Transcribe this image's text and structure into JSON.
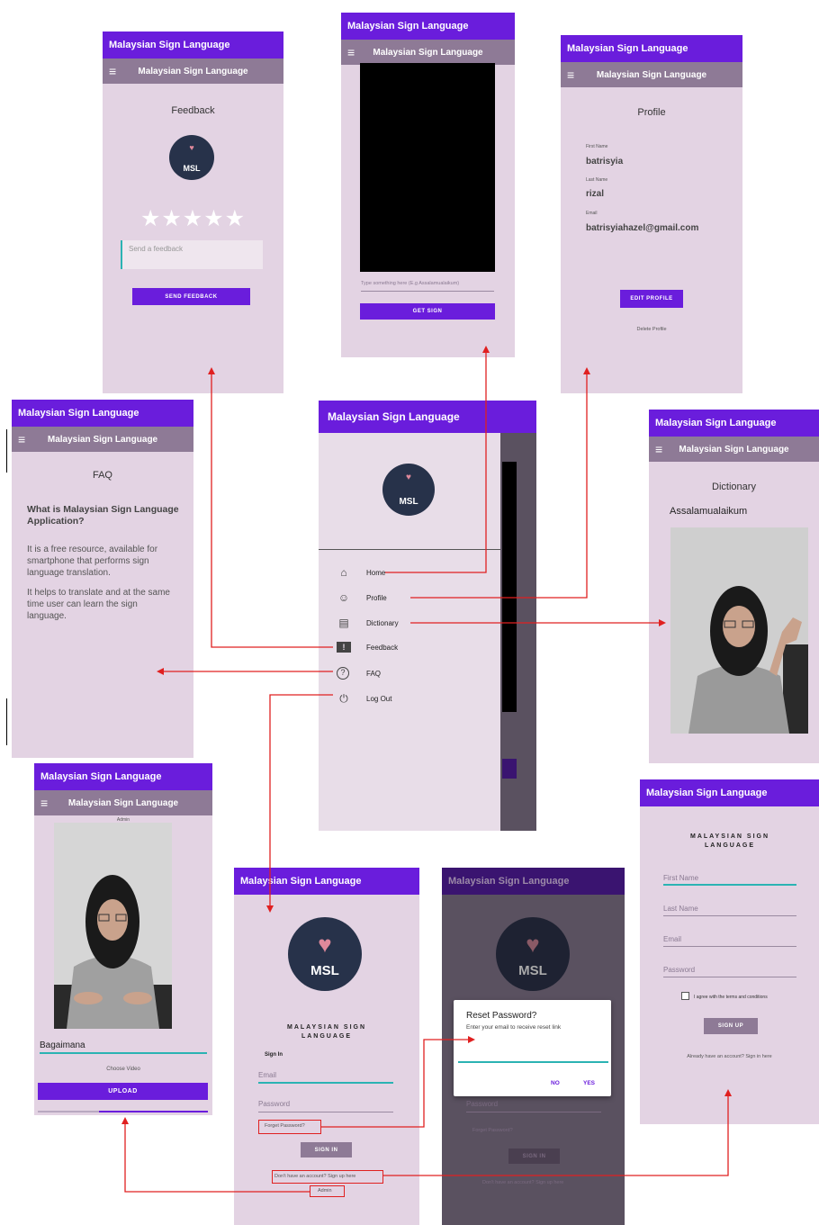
{
  "app_title": "Malaysian Sign Language",
  "feedback": {
    "heading": "Feedback",
    "logo_text": "MSL",
    "stars": "★★★★★",
    "placeholder": "Send a feedback",
    "button": "SEND FEEDBACK"
  },
  "translate": {
    "placeholder": "Type something here (E.g Assalamualaikum)",
    "button": "GET SIGN"
  },
  "profile": {
    "heading": "Profile",
    "first_label": "First Name",
    "first_value": "batrisyia",
    "last_label": "Last Name",
    "last_value": "rizal",
    "email_label": "Email",
    "email_value": "batrisyiahazel@gmail.com",
    "edit_button": "EDIT PROFILE",
    "delete_link": "Delete Profile"
  },
  "faq": {
    "heading": "FAQ",
    "question": "What is Malaysian Sign Language Application?",
    "answer1": "It is a free resource, available for smartphone that performs sign language translation.",
    "answer2": "It helps to translate and at the same time user can learn the sign language."
  },
  "drawer": {
    "logo_text": "MSL",
    "items": [
      {
        "label": "Home",
        "icon": "home-icon",
        "glyph": "⌂"
      },
      {
        "label": "Profile",
        "icon": "account-icon",
        "glyph": "☺"
      },
      {
        "label": "Dictionary",
        "icon": "book-icon",
        "glyph": "▤"
      },
      {
        "label": "Feedback",
        "icon": "feedback-icon",
        "glyph": "!"
      },
      {
        "label": "FAQ",
        "icon": "help-icon",
        "glyph": "?"
      },
      {
        "label": "Log Out",
        "icon": "power-icon",
        "glyph": "⏻"
      }
    ]
  },
  "dictionary": {
    "heading": "Dictionary",
    "word": "Assalamualaikum"
  },
  "admin": {
    "header": "Admin",
    "word": "Bagaimana",
    "choose": "Choose Video",
    "button": "UPLOAD"
  },
  "signin": {
    "logo_text": "MSL",
    "title": "MALAYSIAN SIGN LANGUAGE",
    "subtitle": "Sign In",
    "email": "Email",
    "password": "Password",
    "forgot": "Forget Password?",
    "button": "SIGN IN",
    "signup_link": "Don't have an account? Sign up here",
    "admin_link": "Admin"
  },
  "reset": {
    "title": "Reset Password?",
    "message": "Enter your email to receive reset link",
    "no": "NO",
    "yes": "YES",
    "bg_password": "Password",
    "bg_forgot": "Forget Password?",
    "bg_button": "SIGN IN",
    "bg_link": "Don't have an account? Sign up here"
  },
  "signup": {
    "title": "MALAYSIAN SIGN LANGUAGE",
    "first": "First Name",
    "last": "Last Name",
    "email": "Email",
    "password": "Password",
    "agree": "I agree with the terms and conditions",
    "button": "SIGN UP",
    "signin_link": "Already have an account? Sign in here"
  },
  "colors": {
    "primary": "#6a1ddc",
    "toolbar": "#8e7a96",
    "background": "#e3d3e3",
    "arrow": "#e02020"
  }
}
